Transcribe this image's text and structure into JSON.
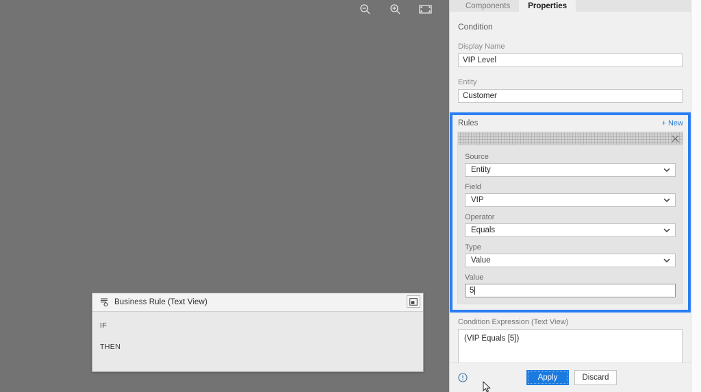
{
  "canvas": {
    "toolbar": [
      {
        "name": "zoom-out-icon",
        "label": "Zoom Out"
      },
      {
        "name": "zoom-in-icon",
        "label": "Zoom In"
      },
      {
        "name": "fit-to-screen-icon",
        "label": "Fit To Screen"
      }
    ]
  },
  "business_rule_panel": {
    "title": "Business Rule (Text View)",
    "lines": [
      "IF",
      "THEN"
    ],
    "expand_label": "Restore"
  },
  "properties": {
    "tabs": [
      {
        "label": "Components",
        "active": false
      },
      {
        "label": "Properties",
        "active": true
      }
    ],
    "section_heading": "Condition",
    "display_name": {
      "label": "Display Name",
      "value": "VIP Level"
    },
    "entity": {
      "label": "Entity",
      "value": "Customer"
    },
    "rules": {
      "title": "Rules",
      "new_label": "+ New",
      "highlight_color": "#2b7ef2",
      "card": {
        "close_label": "Remove rule",
        "fields": [
          {
            "label": "Source",
            "value": "Entity",
            "type": "select"
          },
          {
            "label": "Field",
            "value": "VIP",
            "type": "select"
          },
          {
            "label": "Operator",
            "value": "Equals",
            "type": "select"
          },
          {
            "label": "Type",
            "value": "Value",
            "type": "select"
          },
          {
            "label": "Value",
            "value": "5",
            "type": "text"
          }
        ]
      }
    },
    "condition_expression": {
      "label": "Condition Expression (Text View)",
      "value": "(VIP Equals [5])"
    },
    "footer": {
      "info_label": "Info",
      "apply_label": "Apply",
      "discard_label": "Discard",
      "apply_color": "#1a7ae0"
    }
  }
}
